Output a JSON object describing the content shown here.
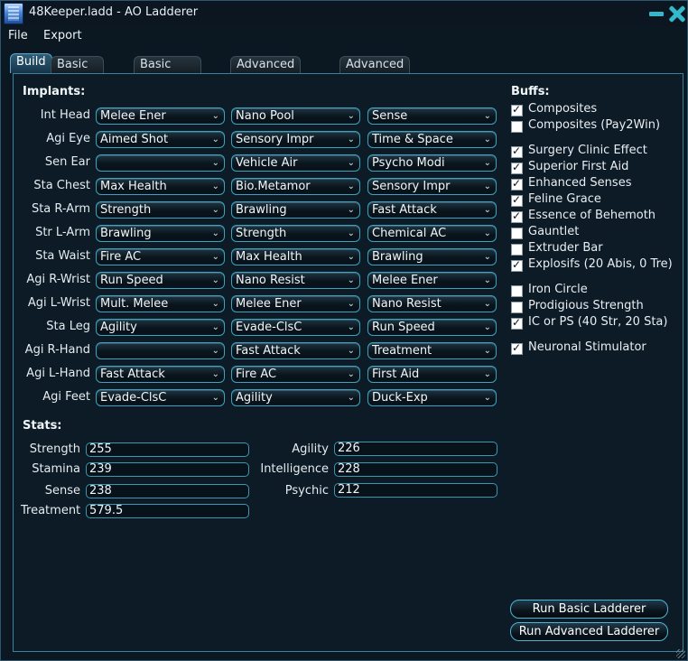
{
  "window": {
    "title": "48Keeper.ladd - AO Ladderer"
  },
  "menu": {
    "file": "File",
    "export": "Export"
  },
  "tabs": [
    "Build",
    "Basic Ladder",
    "Basic Shopping",
    "Advanced Ladder",
    "Advanced Shopping"
  ],
  "implants": {
    "title": "Implants:",
    "rows": [
      {
        "label": "Int Head",
        "slots": [
          "Melee Ener",
          "Nano Pool",
          "Sense"
        ]
      },
      {
        "label": "Agi Eye",
        "slots": [
          "Aimed Shot",
          "Sensory Impr",
          "Time & Space"
        ]
      },
      {
        "label": "Sen Ear",
        "slots": [
          "",
          "Vehicle Air",
          "Psycho Modi"
        ]
      },
      {
        "label": "Sta Chest",
        "slots": [
          "Max Health",
          "Bio.Metamor",
          "Sensory Impr"
        ]
      },
      {
        "label": "Sta R-Arm",
        "slots": [
          "Strength",
          "Brawling",
          "Fast Attack"
        ]
      },
      {
        "label": "Str L-Arm",
        "slots": [
          "Brawling",
          "Strength",
          "Chemical AC"
        ]
      },
      {
        "label": "Sta Waist",
        "slots": [
          "Fire AC",
          "Max Health",
          "Brawling"
        ]
      },
      {
        "label": "Agi R-Wrist",
        "slots": [
          "Run Speed",
          "Nano Resist",
          "Melee Ener"
        ]
      },
      {
        "label": "Agi L-Wrist",
        "slots": [
          "Mult. Melee",
          "Melee Ener",
          "Nano Resist"
        ]
      },
      {
        "label": "Sta Leg",
        "slots": [
          "Agility",
          "Evade-ClsC",
          "Run Speed"
        ]
      },
      {
        "label": "Agi R-Hand",
        "slots": [
          "",
          "Fast Attack",
          "Treatment"
        ]
      },
      {
        "label": "Agi L-Hand",
        "slots": [
          "Fast Attack",
          "Fire AC",
          "First Aid"
        ]
      },
      {
        "label": "Agi Feet",
        "slots": [
          "Evade-ClsC",
          "Agility",
          "Duck-Exp"
        ]
      }
    ]
  },
  "stats": {
    "title": "Stats:",
    "left": [
      {
        "label": "Strength",
        "value": "255"
      },
      {
        "label": "Stamina",
        "value": "239"
      },
      {
        "label": "Sense",
        "value": "238"
      },
      {
        "label": "Treatment",
        "value": "579.5"
      }
    ],
    "right": [
      {
        "label": "Agility",
        "value": "226"
      },
      {
        "label": "Intelligence",
        "value": "228"
      },
      {
        "label": "Psychic",
        "value": "212"
      }
    ]
  },
  "buffs": {
    "title": "Buffs:",
    "items": [
      {
        "label": "Composites",
        "checked": true
      },
      {
        "label": "Composites (Pay2Win)",
        "checked": false
      },
      {
        "label": "Surgery Clinic Effect",
        "checked": true
      },
      {
        "label": "Superior First Aid",
        "checked": true
      },
      {
        "label": "Enhanced Senses",
        "checked": true
      },
      {
        "label": "Feline Grace",
        "checked": true
      },
      {
        "label": "Essence of Behemoth",
        "checked": true
      },
      {
        "label": "Gauntlet",
        "checked": false
      },
      {
        "label": "Extruder Bar",
        "checked": false
      },
      {
        "label": "Explosifs (20 Abis, 0 Tre)",
        "checked": true
      },
      {
        "label": "Iron Circle",
        "checked": false
      },
      {
        "label": "Prodigious Strength",
        "checked": false
      },
      {
        "label": "IC or PS (40 Str, 20 Sta)",
        "checked": true
      },
      {
        "label": "Neuronal Stimulator",
        "checked": true
      }
    ]
  },
  "actions": {
    "run_basic": "Run Basic Ladderer",
    "run_advanced": "Run Advanced Ladderer"
  }
}
